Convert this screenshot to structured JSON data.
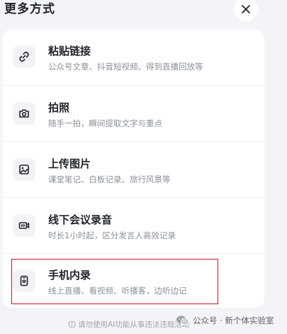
{
  "header": {
    "title": "更多方式",
    "close_icon": "close-icon"
  },
  "options": [
    {
      "title": "粘贴链接",
      "subtitle": "公众号文章、抖音短视频、得到直播回放等",
      "icon": "link-icon"
    },
    {
      "title": "拍照",
      "subtitle": "随手一拍，瞬间提取文字与重点",
      "icon": "camera-icon"
    },
    {
      "title": "上传图片",
      "subtitle": "课堂笔记、白板记录、旅行风景等",
      "icon": "image-icon"
    },
    {
      "title": "线下会议录音",
      "subtitle": "时长1小时起，区分发言人高效记录",
      "icon": "meeting-recorder-icon"
    },
    {
      "title": "手机内录",
      "subtitle": "线上直播、看视频、听播客，边听边记",
      "icon": "phone-recording-icon"
    }
  ],
  "footer": {
    "disclaimer": "请勿使用AI功能从事违法违规活动"
  },
  "watermark": {
    "text": "公众号 · 新个体实验室",
    "icon": "wechat-icon"
  },
  "colors": {
    "background": "#f3f4f7",
    "card": "#ffffff",
    "highlight_border": "#c8102e",
    "subtitle": "#8a8f99"
  }
}
